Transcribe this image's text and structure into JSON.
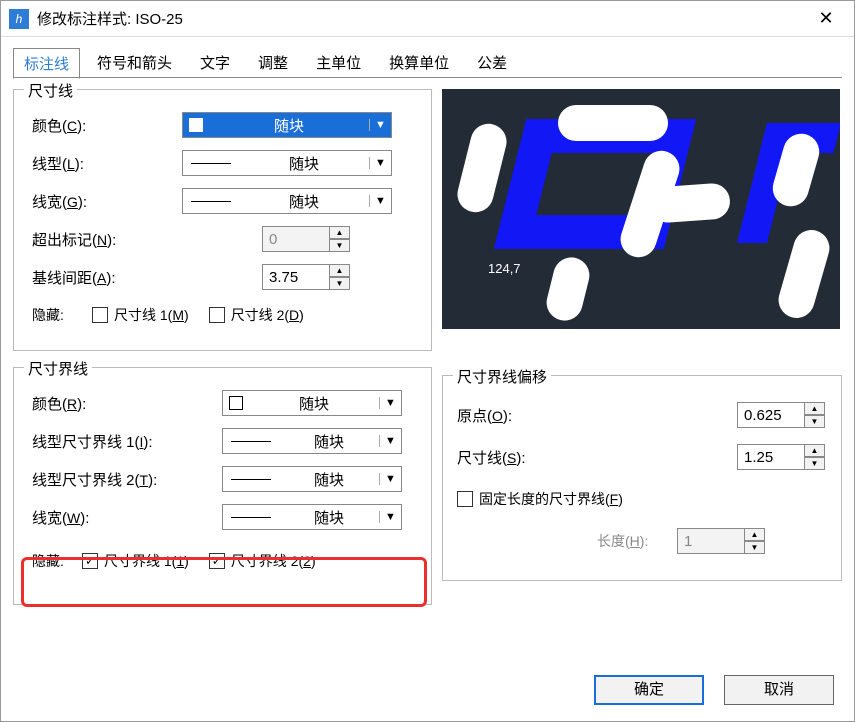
{
  "window": {
    "title": "修改标注样式: ISO-25"
  },
  "tabs": {
    "t0": "标注线",
    "t1": "符号和箭头",
    "t2": "文字",
    "t3": "调整",
    "t4": "主单位",
    "t5": "换算单位",
    "t6": "公差"
  },
  "dimline": {
    "title": "尺寸线",
    "color_label": "颜色(C):",
    "color_value": "随块",
    "linetype_label": "线型(L):",
    "linetype_value": "随块",
    "lineweight_label": "线宽(G):",
    "lineweight_value": "随块",
    "extend_label": "超出标记(N):",
    "extend_value": "0",
    "baseline_label": "基线间距(A):",
    "baseline_value": "3.75",
    "hide_label": "隐藏:",
    "hide1": "尺寸线 1(M)",
    "hide2": "尺寸线 2(D)"
  },
  "extline": {
    "title": "尺寸界线",
    "color_label": "颜色(R):",
    "color_value": "随块",
    "lt1_label": "线型尺寸界线 1(I):",
    "lt1_value": "随块",
    "lt2_label": "线型尺寸界线 2(T):",
    "lt2_value": "随块",
    "lw_label": "线宽(W):",
    "lw_value": "随块",
    "hide_label": "隐藏:",
    "hide1": "尺寸界线 1(1)",
    "hide2": "尺寸界线 2(2)"
  },
  "offset": {
    "title": "尺寸界线偏移",
    "origin_label": "原点(O):",
    "origin_value": "0.625",
    "dimline_label": "尺寸线(S):",
    "dimline_value": "1.25",
    "fixed_label": "固定长度的尺寸界线(F)",
    "len_label": "长度(H):",
    "len_value": "1"
  },
  "preview": {
    "text": "124,7"
  },
  "buttons": {
    "ok": "确定",
    "cancel": "取消"
  }
}
